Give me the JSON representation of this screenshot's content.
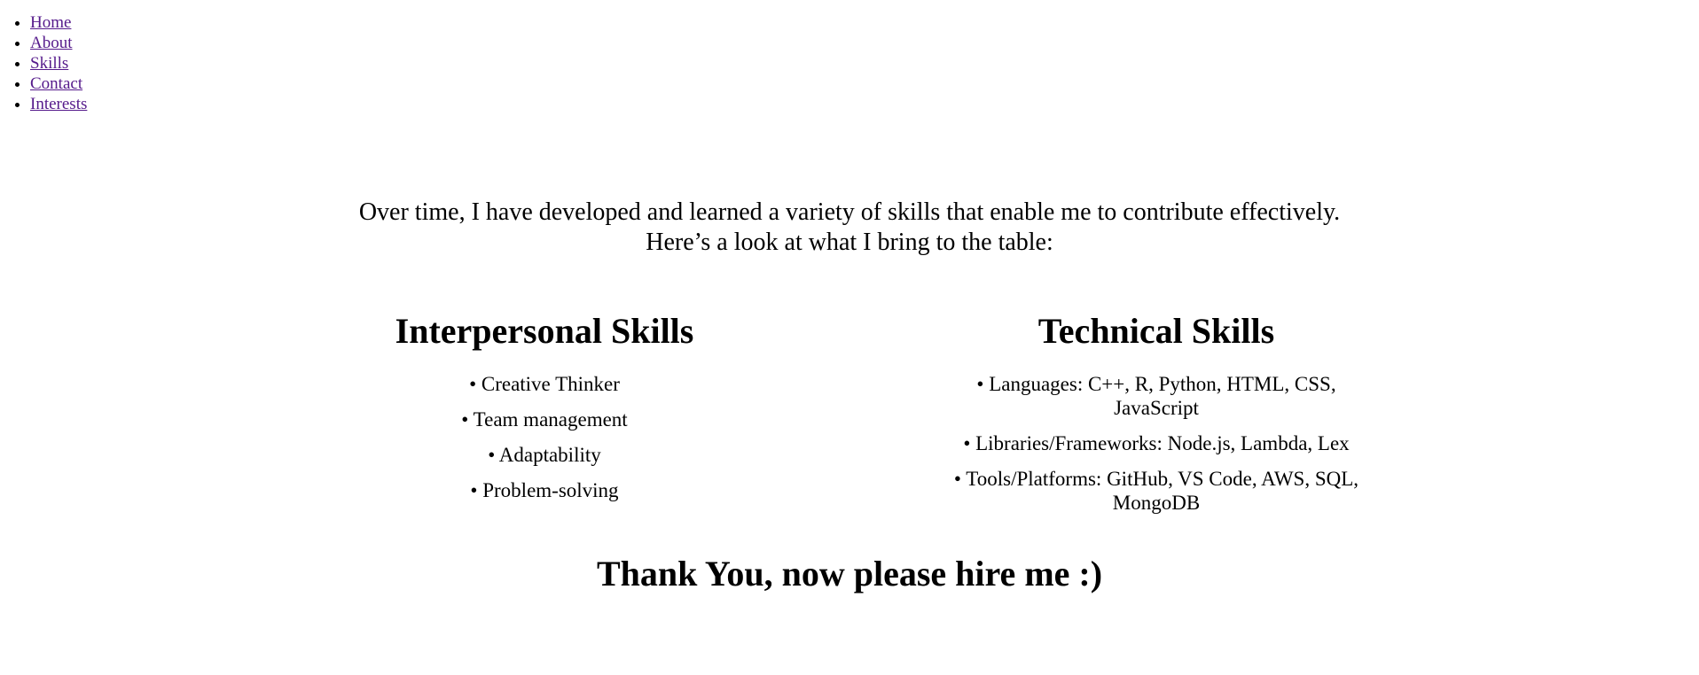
{
  "nav": {
    "items": [
      {
        "label": "Home"
      },
      {
        "label": "About"
      },
      {
        "label": "Skills"
      },
      {
        "label": "Contact"
      },
      {
        "label": "Interests"
      }
    ]
  },
  "intro": {
    "line1": "Over time, I have developed and learned a variety of skills that enable me to contribute effectively.",
    "line2": "Here’s a look at what I bring to the table:"
  },
  "interpersonal": {
    "title": "Interpersonal Skills",
    "items": [
      "• Creative Thinker",
      "• Team management",
      "• Adaptability",
      "• Problem-solving"
    ]
  },
  "technical": {
    "title": "Technical Skills",
    "items": [
      "• Languages: C++, R, Python, HTML, CSS, JavaScript",
      "• Libraries/Frameworks: Node.js, Lambda, Lex",
      "• Tools/Platforms: GitHub, VS Code, AWS, SQL, MongoDB"
    ]
  },
  "closing": {
    "text": "Thank You, now please hire me :)"
  },
  "colors": {
    "link": "#551a8b",
    "text": "#000000",
    "background": "#ffffff"
  }
}
